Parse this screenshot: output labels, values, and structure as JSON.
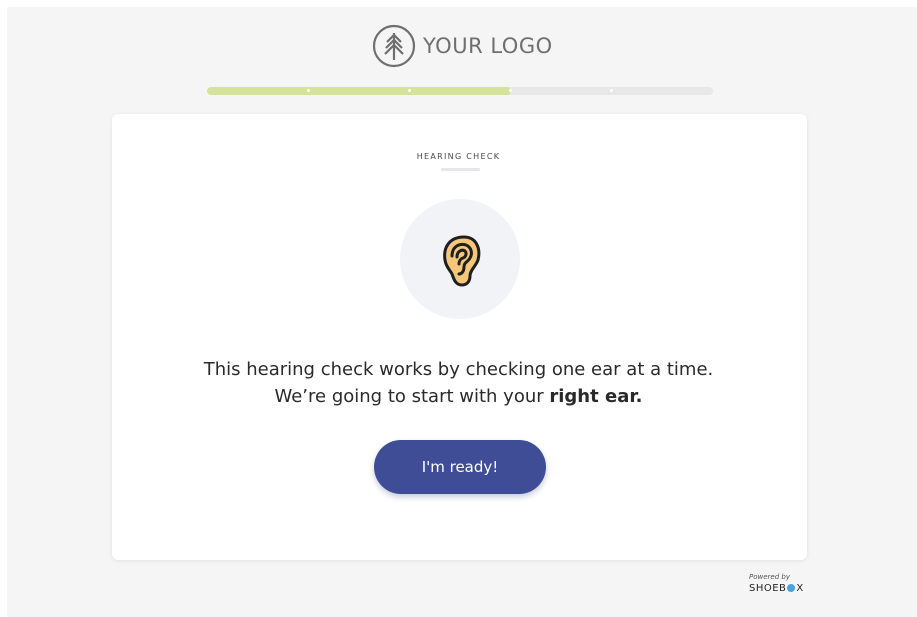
{
  "header": {
    "logo_text": "YOUR LOGO",
    "logo_icon": "tree-icon"
  },
  "progress": {
    "fraction": 0.6,
    "steps": 5,
    "fill_color": "#d3e39a",
    "track_color": "#e8e8e8"
  },
  "card": {
    "step_label": "HEARING CHECK",
    "icon": "ear-icon",
    "message_line1": "This hearing check works by checking one ear at a time.",
    "message_line2_prefix": "We’re going to start with your ",
    "message_line2_bold": "right ear.",
    "button_label": "I'm ready!",
    "button_color": "#3f4d96"
  },
  "footer": {
    "powered_by": "Powered by",
    "brand_prefix": "SHOEB",
    "brand_suffix": "X"
  }
}
